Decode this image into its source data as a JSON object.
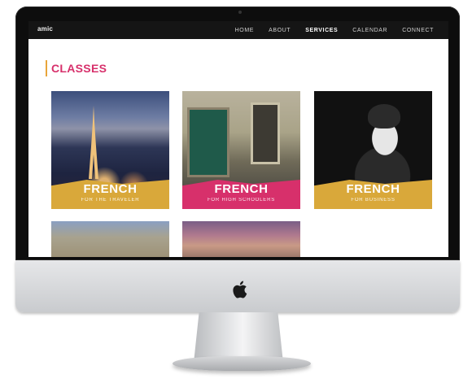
{
  "nav": {
    "logo": "amic",
    "items": [
      "HOME",
      "ABOUT",
      "SERVICES",
      "CALENDAR",
      "CONNECT"
    ],
    "active_index": 2
  },
  "section": {
    "title": "CLASSES"
  },
  "cards": [
    {
      "title": "FRENCH",
      "subtitle": "FOR THE TRAVELER",
      "banner_color": "#d9a83a"
    },
    {
      "title": "FRENCH",
      "subtitle": "FOR HIGH SCHOOLERS",
      "banner_color": "#d7306b"
    },
    {
      "title": "FRENCH",
      "subtitle": "FOR BUSINESS",
      "banner_color": "#d9a83a"
    }
  ],
  "colors": {
    "accent_pink": "#d7306b",
    "accent_gold": "#e8a53a",
    "nav_bg": "#151515"
  }
}
